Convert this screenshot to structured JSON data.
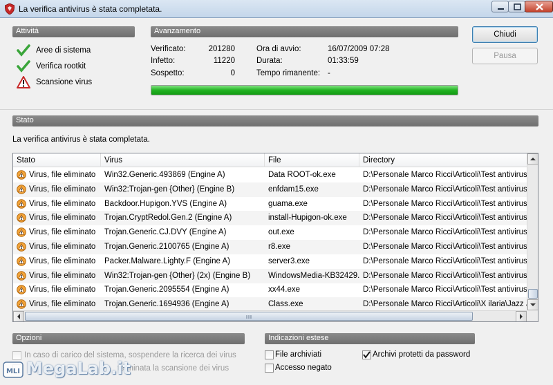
{
  "window": {
    "title": "La verifica antivirus è stata completata."
  },
  "activity": {
    "header": "Attività",
    "items": [
      {
        "label": "Aree di sistema",
        "status": "done"
      },
      {
        "label": "Verifica rootkit",
        "status": "done"
      },
      {
        "label": "Scansione virus",
        "status": "warning"
      }
    ]
  },
  "progress": {
    "header": "Avanzamento",
    "verified_label": "Verificato:",
    "verified_value": "201280",
    "infected_label": "Infetto:",
    "infected_value": "11220",
    "suspected_label": "Sospetto:",
    "suspected_value": "0",
    "start_label": "Ora di avvio:",
    "start_value": "16/07/2009 07:28",
    "duration_label": "Durata:",
    "duration_value": "01:33:59",
    "remaining_label": "Tempo rimanente:",
    "remaining_value": "-",
    "percent": 100,
    "bar_color": "#22b322"
  },
  "buttons": {
    "close": "Chiudi",
    "pause": "Pausa"
  },
  "status": {
    "header": "Stato",
    "message": "La verifica antivirus è stata completata."
  },
  "table": {
    "columns": [
      "Stato",
      "Virus",
      "File",
      "Directory"
    ],
    "rows": [
      {
        "stato": "Virus, file eliminato",
        "virus": "Win32.Generic.493869 (Engine A)",
        "file": "Data ROOT-ok.exe",
        "directory": "D:\\Personale Marco Ricci\\Articoli\\Test antivirus\\sp"
      },
      {
        "stato": "Virus, file eliminato",
        "virus": "Win32:Trojan-gen {Other} (Engine B)",
        "file": "enfdam15.exe",
        "directory": "D:\\Personale Marco Ricci\\Articoli\\Test antivirus\\sp"
      },
      {
        "stato": "Virus, file eliminato",
        "virus": "Backdoor.Hupigon.YVS (Engine A)",
        "file": "guama.exe",
        "directory": "D:\\Personale Marco Ricci\\Articoli\\Test antivirus\\sp"
      },
      {
        "stato": "Virus, file eliminato",
        "virus": "Trojan.CryptRedol.Gen.2 (Engine A)",
        "file": "install-Hupigon-ok.exe",
        "directory": "D:\\Personale Marco Ricci\\Articoli\\Test antivirus\\sp"
      },
      {
        "stato": "Virus, file eliminato",
        "virus": "Trojan.Generic.CJ.DVY (Engine A)",
        "file": "out.exe",
        "directory": "D:\\Personale Marco Ricci\\Articoli\\Test antivirus\\sp"
      },
      {
        "stato": "Virus, file eliminato",
        "virus": "Trojan.Generic.2100765 (Engine A)",
        "file": "r8.exe",
        "directory": "D:\\Personale Marco Ricci\\Articoli\\Test antivirus\\sp"
      },
      {
        "stato": "Virus, file eliminato",
        "virus": "Packer.Malware.Lighty.F (Engine A)",
        "file": "server3.exe",
        "directory": "D:\\Personale Marco Ricci\\Articoli\\Test antivirus\\sp"
      },
      {
        "stato": "Virus, file eliminato",
        "virus": "Win32:Trojan-gen {Other} (2x) (Engine B)",
        "file": "WindowsMedia-KB32429...",
        "directory": "D:\\Personale Marco Ricci\\Articoli\\Test antivirus\\sp"
      },
      {
        "stato": "Virus, file eliminato",
        "virus": "Trojan.Generic.2095554 (Engine A)",
        "file": "xx44.exe",
        "directory": "D:\\Personale Marco Ricci\\Articoli\\Test antivirus\\sp"
      },
      {
        "stato": "Virus, file eliminato",
        "virus": "Trojan.Generic.1694936 (Engine A)",
        "file": "Class.exe",
        "directory": "D:\\Personale Marco Ricci\\Articoli\\X ilaria\\Jazz Jack"
      }
    ]
  },
  "options": {
    "header": "Opzioni",
    "opt1": "In caso di carico del sistema, sospendere la ricerca dei virus",
    "opt2": "terminata la scansione dei virus"
  },
  "extended": {
    "header": "Indicazioni estese",
    "archived_files": "File archiviati",
    "access_denied": "Accesso negato",
    "password_archives": "Archivi protetti da password"
  },
  "watermark": {
    "text": "MegaLab.it"
  },
  "colors": {
    "section_bar": "#7a7a7a",
    "check_green": "#3aa53a",
    "warning_orange": "#e58a1a"
  }
}
